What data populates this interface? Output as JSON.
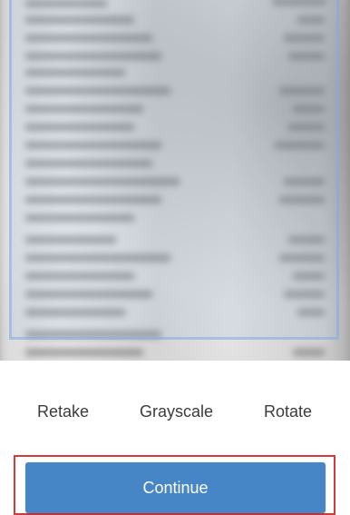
{
  "actions": {
    "retake": "Retake",
    "grayscale": "Grayscale",
    "rotate": "Rotate"
  },
  "continue_label": "Continue",
  "colors": {
    "primary": "#4686c6",
    "highlight_border": "#d33a3a",
    "scan_frame": "#85aade"
  }
}
